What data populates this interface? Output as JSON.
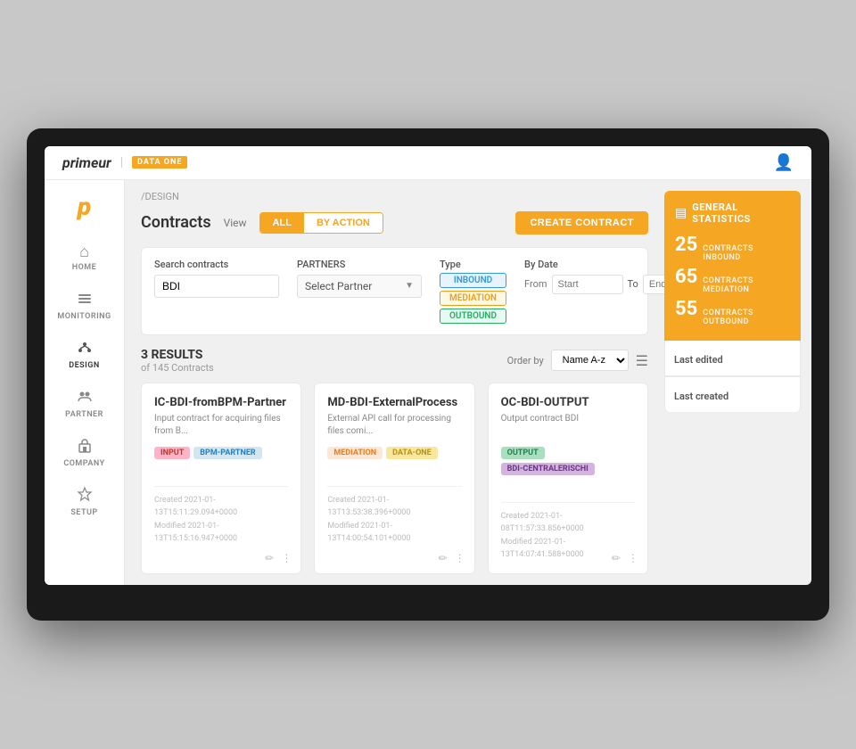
{
  "brand": {
    "name": "primeur",
    "tag": "DATA ONE"
  },
  "header": {
    "breadcrumb": "/DESIGN"
  },
  "sidebar": {
    "items": [
      {
        "id": "home",
        "label": "HOME",
        "icon": "⌂"
      },
      {
        "id": "monitoring",
        "label": "MONITORING",
        "icon": "☰"
      },
      {
        "id": "design",
        "label": "DESIGN",
        "icon": "⚙"
      },
      {
        "id": "partner",
        "label": "PARTNER",
        "icon": "✦"
      },
      {
        "id": "company",
        "label": "COMPANY",
        "icon": "⊞"
      },
      {
        "id": "setup",
        "label": "SETUP",
        "icon": "✿"
      }
    ]
  },
  "page": {
    "title": "Contracts",
    "view_label": "View",
    "tabs": [
      {
        "id": "all",
        "label": "ALL",
        "active": true
      },
      {
        "id": "by-action",
        "label": "BY ACTION",
        "active": false
      }
    ],
    "create_button": "CREATE CONTRACT"
  },
  "search": {
    "label": "Search contracts",
    "value": "BDI",
    "partner_label": "PARTNERS",
    "partner_placeholder": "Select Partner",
    "type_label": "Type",
    "types": [
      "INBOUND",
      "MEDIATION",
      "OUTBOUND"
    ],
    "date_label": "By Date",
    "date_from_label": "From",
    "date_from_placeholder": "Start",
    "date_to_label": "To",
    "date_to_placeholder": "End"
  },
  "results": {
    "count": "3 RESULTS",
    "subtitle": "of 145 Contracts",
    "order_label": "Order by",
    "order_value": "Name A-z"
  },
  "contracts": [
    {
      "id": "IC-BDI-fromBPM-Partner",
      "title": "IC-BDI-fromBPM-Partner",
      "description": "Input contract for acquiring files from B...",
      "tags": [
        {
          "label": "INPUT",
          "type": "input"
        },
        {
          "label": "BPM-PARTNER",
          "type": "bpm-partner"
        }
      ],
      "created": "Created 2021-01-13T15:11:29.094+0000",
      "modified": "Modified 2021-01-13T15:15:16.947+0000"
    },
    {
      "id": "MD-BDI-ExternalProcess",
      "title": "MD-BDI-ExternalProcess",
      "description": "External API call for processing files comi...",
      "tags": [
        {
          "label": "MEDIATION",
          "type": "mediation"
        },
        {
          "label": "DATA-ONE",
          "type": "data-one"
        }
      ],
      "created": "Created 2021-01-13T13:53:38.396+0000",
      "modified": "Modified 2021-01-13T14:00:54.101+0000"
    },
    {
      "id": "OC-BDI-OUTPUT",
      "title": "OC-BDI-OUTPUT",
      "description": "Output contract BDI",
      "tags": [
        {
          "label": "OUTPUT",
          "type": "output"
        },
        {
          "label": "BDI-CENTRALERISCHI",
          "type": "bdi-central"
        }
      ],
      "created": "Created 2021-01-08T11:57:33.856+0000",
      "modified": "Modified 2021-01-13T14:07:41.588+0000"
    }
  ],
  "stats": {
    "title": "General statistics",
    "items": [
      {
        "number": "25",
        "label": "CONTRACTS INBOUND"
      },
      {
        "number": "65",
        "label": "CONTRACTS MEDIATION"
      },
      {
        "number": "55",
        "label": "CONTRACTS OUTBOUND"
      }
    ],
    "last_edited_label": "Last edited",
    "last_created_label": "Last created"
  }
}
